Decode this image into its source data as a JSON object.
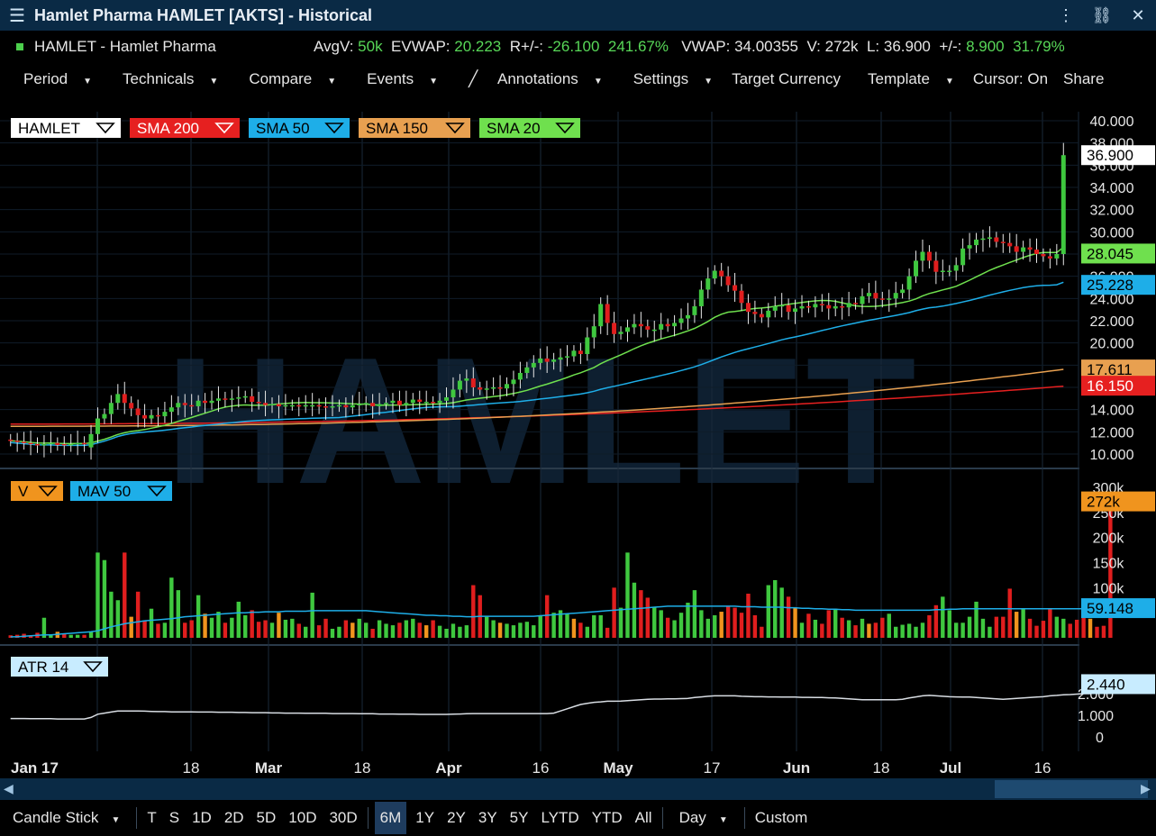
{
  "window": {
    "title": "Hamlet Pharma HAMLET [AKTS] - Historical"
  },
  "quote": {
    "name": "HAMLET - Hamlet Pharma",
    "avgv_label": "AvgV:",
    "avgv": "50k",
    "evwap_label": "EVWAP:",
    "evwap": "20.223",
    "rpm_label": "R+/-:",
    "rpm": "-26.100",
    "rpm_pct": "241.67%",
    "vwap_label": "VWAP:",
    "vwap": "34.00355",
    "v_label": "V:",
    "v": "272k",
    "l_label": "L:",
    "l": "36.900",
    "pm_label": "+/-:",
    "pm": "8.900",
    "pm_pct": "31.79%"
  },
  "toolbar": {
    "period": "Period",
    "technicals": "Technicals",
    "compare": "Compare",
    "events": "Events",
    "annotations": "Annotations",
    "settings": "Settings",
    "target_currency": "Target Currency",
    "template": "Template",
    "cursor": "Cursor: On",
    "share": "Share"
  },
  "legend": {
    "hamlet": "HAMLET",
    "sma200": "SMA 200",
    "sma50": "SMA 50",
    "sma150": "SMA 150",
    "sma20": "SMA 20",
    "v": "V",
    "mav50": "MAV 50",
    "atr": "ATR 14"
  },
  "watermark": "HAMLET",
  "colors": {
    "up": "#3fc83f",
    "down": "#e01e1e",
    "neutral": "#f0941e",
    "sma200": "#e62020",
    "sma50": "#1eaee8",
    "sma150": "#e8a050",
    "sma20": "#6fe04e",
    "mav50": "#1eaee8",
    "atr": "#d8dde3",
    "bg": "#000000",
    "grid": "#1a2a3a"
  },
  "chart_data": [
    {
      "type": "candlestick",
      "panel": "price",
      "x_ticks": [
        "Jan 17",
        "18",
        "Mar",
        "18",
        "Apr",
        "16",
        "May",
        "17",
        "Jun",
        "18",
        "Jul",
        "16"
      ],
      "y_ticks": [
        "40.000",
        "38.000",
        "36.000",
        "34.000",
        "32.000",
        "30.000",
        "28.000",
        "26.000",
        "24.000",
        "22.000",
        "20.000",
        "18.000",
        "16.000",
        "14.000",
        "12.000",
        "10.000"
      ],
      "ylim": [
        10,
        40
      ],
      "last_labels": {
        "price": "36.900",
        "sma20": "28.045",
        "sma50": "25.228",
        "sma150": "17.611",
        "sma200": "16.150"
      },
      "close": [
        11.2,
        11.1,
        11.0,
        10.9,
        10.8,
        10.9,
        11.0,
        10.8,
        10.8,
        10.9,
        11.0,
        10.9,
        11.8,
        13.2,
        13.6,
        14.6,
        15.4,
        14.6,
        14.1,
        13.5,
        13.2,
        13.5,
        13.4,
        13.8,
        14.2,
        14.6,
        14.4,
        14.3,
        14.8,
        14.6,
        14.8,
        15.0,
        14.9,
        15.0,
        15.1,
        15.2,
        14.7,
        14.6,
        14.4,
        14.5,
        14.3,
        14.4,
        14.4,
        14.3,
        14.4,
        14.4,
        14.3,
        14.2,
        14.3,
        14.4,
        14.2,
        14.4,
        14.5,
        14.6,
        14.3,
        14.5,
        14.6,
        14.8,
        14.4,
        14.6,
        14.9,
        14.7,
        14.7,
        14.6,
        14.8,
        15.1,
        15.8,
        16.6,
        16.8,
        16.0,
        15.8,
        15.9,
        16.0,
        15.9,
        16.3,
        16.7,
        17.3,
        17.8,
        18.2,
        18.6,
        18.3,
        18.5,
        18.7,
        18.8,
        19.3,
        19.0,
        20.5,
        21.5,
        23.5,
        21.8,
        20.8,
        21.0,
        21.4,
        21.7,
        21.5,
        21.2,
        21.2,
        21.7,
        21.5,
        21.8,
        22.2,
        22.5,
        23.3,
        24.8,
        25.8,
        26.5,
        26.0,
        25.2,
        24.7,
        23.6,
        22.8,
        22.6,
        22.3,
        22.9,
        23.3,
        23.4,
        22.8,
        23.1,
        23.3,
        23.2,
        23.5,
        23.4,
        23.1,
        23.3,
        23.2,
        23.6,
        23.5,
        24.2,
        24.5,
        24.0,
        23.9,
        24.0,
        24.5,
        24.8,
        26.0,
        27.4,
        28.2,
        27.4,
        26.4,
        26.5,
        26.5,
        27.0,
        28.5,
        28.8,
        29.3,
        29.4,
        29.5,
        29.1,
        29.0,
        28.7,
        28.2,
        28.6,
        28.4,
        28.0,
        27.8,
        27.6,
        28.0,
        36.9
      ],
      "open": [
        11.3,
        11.2,
        11.1,
        11.0,
        10.9,
        10.8,
        10.9,
        11.0,
        10.9,
        10.8,
        10.9,
        11.0,
        10.6,
        11.8,
        13.2,
        13.6,
        14.6,
        15.4,
        14.6,
        14.1,
        13.5,
        13.2,
        13.5,
        13.4,
        13.8,
        14.2,
        14.6,
        14.4,
        14.3,
        14.8,
        14.6,
        14.8,
        15.0,
        14.9,
        15.0,
        15.1,
        15.2,
        14.7,
        14.6,
        14.4,
        14.5,
        14.3,
        14.4,
        14.4,
        14.3,
        14.4,
        14.4,
        14.3,
        14.2,
        14.3,
        14.4,
        14.2,
        14.4,
        14.5,
        14.6,
        14.3,
        14.5,
        14.6,
        14.8,
        14.4,
        14.6,
        14.9,
        14.7,
        14.7,
        14.6,
        14.8,
        15.1,
        15.8,
        16.6,
        16.8,
        16.0,
        15.8,
        15.9,
        16.0,
        15.9,
        16.3,
        16.7,
        17.3,
        17.8,
        18.2,
        18.6,
        18.3,
        18.5,
        18.7,
        18.8,
        19.3,
        19.0,
        20.5,
        21.5,
        23.5,
        21.8,
        20.8,
        21.0,
        21.4,
        21.7,
        21.5,
        21.2,
        21.2,
        21.7,
        21.5,
        21.8,
        22.2,
        22.5,
        23.3,
        24.8,
        25.8,
        26.5,
        26.0,
        25.2,
        24.7,
        23.6,
        22.8,
        22.6,
        22.3,
        22.9,
        23.3,
        23.4,
        22.8,
        23.1,
        23.3,
        23.2,
        23.5,
        23.4,
        23.1,
        23.3,
        23.2,
        23.6,
        23.5,
        24.2,
        24.5,
        24.0,
        23.9,
        24.0,
        24.5,
        24.8,
        26.0,
        27.4,
        28.2,
        27.4,
        26.4,
        26.5,
        26.5,
        27.0,
        28.5,
        28.8,
        29.3,
        29.4,
        29.5,
        29.1,
        29.0,
        28.7,
        28.2,
        28.6,
        28.4,
        28.0,
        27.8,
        27.6,
        28.0
      ]
    },
    {
      "type": "bar",
      "panel": "volume",
      "y_ticks": [
        "300k",
        "250k",
        "200k",
        "150k",
        "100k",
        "50k"
      ],
      "ylim": [
        0,
        300
      ],
      "last_labels": {
        "volume": "272k",
        "mav50": "59.148"
      },
      "values": [
        5,
        6,
        8,
        5,
        10,
        40,
        6,
        12,
        8,
        6,
        6,
        6,
        12,
        170,
        155,
        92,
        75,
        170,
        42,
        92,
        35,
        58,
        28,
        30,
        120,
        95,
        30,
        35,
        85,
        48,
        40,
        52,
        30,
        40,
        72,
        45,
        55,
        32,
        35,
        30,
        50,
        36,
        38,
        28,
        22,
        90,
        25,
        38,
        18,
        22,
        35,
        30,
        38,
        30,
        18,
        35,
        28,
        25,
        30,
        35,
        38,
        30,
        25,
        35,
        24,
        18,
        28,
        22,
        25,
        105,
        85,
        42,
        35,
        30,
        28,
        25,
        30,
        32,
        25,
        45,
        85,
        50,
        55,
        48,
        38,
        30,
        22,
        45,
        45,
        20,
        100,
        60,
        170,
        110,
        95,
        80,
        62,
        55,
        40,
        35,
        50,
        70,
        95,
        55,
        38,
        45,
        52,
        62,
        60,
        50,
        88,
        45,
        22,
        105,
        115,
        100,
        82,
        60,
        30,
        48,
        36,
        28,
        55,
        58,
        40,
        35,
        25,
        38,
        28,
        30,
        40,
        48,
        22,
        26,
        28,
        22,
        30,
        45,
        65,
        82,
        55,
        30,
        30,
        42,
        72,
        38,
        22,
        42,
        42,
        98,
        52,
        58,
        38,
        24,
        34,
        58,
        42,
        38,
        28,
        36,
        46,
        38,
        22,
        24,
        272
      ],
      "colors_code": "u=green d=red n=orange",
      "mav50": [
        2,
        2,
        3,
        4,
        5,
        6,
        6,
        7,
        8,
        9,
        10,
        11,
        12,
        14,
        18,
        22,
        25,
        28,
        30,
        32,
        34,
        35,
        36,
        37,
        38,
        40,
        42,
        43,
        44,
        45,
        46,
        47,
        48,
        49,
        50,
        50,
        51,
        51,
        52,
        52,
        52,
        53,
        53,
        53,
        53,
        54,
        54,
        54,
        54,
        54,
        54,
        54,
        54,
        54,
        53,
        52,
        51,
        50,
        49,
        48,
        47,
        46,
        45,
        45,
        44,
        44,
        43,
        43,
        42,
        42,
        43,
        43,
        43,
        43,
        43,
        43,
        43,
        43,
        43,
        44,
        45,
        46,
        47,
        48,
        49,
        50,
        51,
        52,
        53,
        54,
        55,
        56,
        57,
        58,
        59,
        60,
        61,
        62,
        63,
        63,
        63,
        63,
        63,
        63,
        63,
        63,
        63,
        63,
        63,
        62,
        62,
        62,
        61,
        61,
        61,
        61,
        60,
        60,
        59,
        59,
        58,
        58,
        57,
        57,
        56,
        56,
        55,
        55,
        55,
        55,
        55,
        55,
        55,
        55,
        55,
        55,
        55,
        55,
        56,
        56,
        57,
        57,
        58,
        58,
        58,
        58,
        58,
        58,
        58,
        58,
        58,
        58,
        58,
        58,
        58,
        58,
        58,
        58,
        58,
        58,
        58,
        58,
        59,
        59,
        59
      ]
    },
    {
      "type": "line",
      "panel": "atr",
      "name": "ATR 14",
      "y_ticks": [
        "2.000",
        "1.000",
        "0"
      ],
      "ylim": [
        0,
        3
      ],
      "last_label": "2.440",
      "values": [
        0.85,
        0.85,
        0.85,
        0.84,
        0.84,
        0.84,
        0.84,
        0.83,
        0.83,
        0.83,
        0.83,
        0.83,
        0.9,
        1.05,
        1.1,
        1.15,
        1.2,
        1.2,
        1.2,
        1.2,
        1.19,
        1.18,
        1.17,
        1.17,
        1.16,
        1.16,
        1.16,
        1.16,
        1.15,
        1.15,
        1.15,
        1.14,
        1.14,
        1.14,
        1.13,
        1.13,
        1.12,
        1.12,
        1.12,
        1.11,
        1.11,
        1.1,
        1.1,
        1.1,
        1.09,
        1.09,
        1.09,
        1.09,
        1.08,
        1.08,
        1.08,
        1.08,
        1.07,
        1.07,
        1.07,
        1.06,
        1.06,
        1.06,
        1.05,
        1.05,
        1.05,
        1.04,
        1.04,
        1.04,
        1.04,
        1.04,
        1.05,
        1.06,
        1.07,
        1.08,
        1.08,
        1.08,
        1.08,
        1.08,
        1.08,
        1.08,
        1.08,
        1.08,
        1.08,
        1.08,
        1.08,
        1.1,
        1.2,
        1.3,
        1.4,
        1.5,
        1.55,
        1.6,
        1.62,
        1.65,
        1.65,
        1.66,
        1.68,
        1.7,
        1.72,
        1.74,
        1.75,
        1.75,
        1.76,
        1.76,
        1.77,
        1.78,
        1.82,
        1.85,
        1.88,
        1.9,
        1.9,
        1.9,
        1.9,
        1.88,
        1.87,
        1.86,
        1.86,
        1.85,
        1.85,
        1.84,
        1.84,
        1.84,
        1.83,
        1.83,
        1.82,
        1.82,
        1.81,
        1.8,
        1.78,
        1.76,
        1.74,
        1.72,
        1.72,
        1.72,
        1.72,
        1.72,
        1.72,
        1.74,
        1.8,
        1.85,
        1.9,
        1.92,
        1.9,
        1.88,
        1.86,
        1.85,
        1.84,
        1.84,
        1.82,
        1.8,
        1.78,
        1.76,
        1.74,
        1.76,
        1.78,
        1.8,
        1.82,
        1.84,
        1.86,
        1.9,
        1.92,
        1.95,
        1.96,
        1.98,
        2.0,
        2.0,
        2.44
      ]
    }
  ],
  "bottom": {
    "style": "Candle Stick",
    "t": "T",
    "s": "S",
    "d1": "1D",
    "d2": "2D",
    "d5": "5D",
    "d10": "10D",
    "d30": "30D",
    "m6": "6M",
    "y1": "1Y",
    "y2": "2Y",
    "y3": "3Y",
    "y5": "5Y",
    "lytd": "LYTD",
    "ytd": "YTD",
    "all": "All",
    "day": "Day",
    "custom": "Custom"
  }
}
